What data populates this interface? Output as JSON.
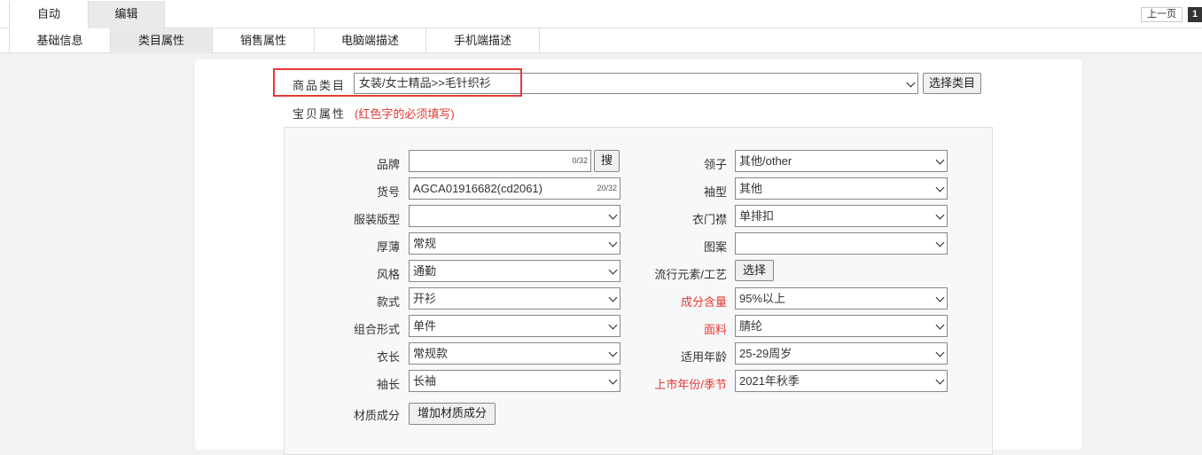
{
  "top_tabs": [
    {
      "label": "自动"
    },
    {
      "label": "编辑"
    }
  ],
  "pager": {
    "prev_label": "上一页",
    "current_page": "1"
  },
  "sub_tabs": [
    {
      "label": "基础信息"
    },
    {
      "label": "类目属性",
      "active": true
    },
    {
      "label": "销售属性"
    },
    {
      "label": "电脑端描述"
    },
    {
      "label": "手机端描述"
    }
  ],
  "category": {
    "label": "商品类目",
    "value": "女装/女士精品>>毛针织衫",
    "select_button": "选择类目"
  },
  "attributes_header": {
    "label": "宝贝属性",
    "note": "(红色字的必须填写)"
  },
  "left_fields": [
    {
      "label": "品牌",
      "type": "text",
      "value": "",
      "counter": "0/32",
      "button": "搜"
    },
    {
      "label": "货号",
      "type": "text",
      "value": "AGCA01916682(cd2061)",
      "counter": "20/32"
    },
    {
      "label": "服装版型",
      "type": "select",
      "value": ""
    },
    {
      "label": "厚薄",
      "type": "select",
      "value": "常规"
    },
    {
      "label": "风格",
      "type": "select",
      "value": "通勤"
    },
    {
      "label": "款式",
      "type": "select",
      "value": "开衫"
    },
    {
      "label": "组合形式",
      "type": "select",
      "value": "单件"
    },
    {
      "label": "衣长",
      "type": "select",
      "value": "常规款"
    },
    {
      "label": "袖长",
      "type": "select",
      "value": "长袖"
    },
    {
      "label": "材质成分",
      "type": "button",
      "button": "增加材质成分"
    }
  ],
  "right_fields": [
    {
      "label": "领子",
      "type": "select",
      "value": "其他/other",
      "required": false
    },
    {
      "label": "袖型",
      "type": "select",
      "value": "其他",
      "required": false
    },
    {
      "label": "衣门襟",
      "type": "select",
      "value": "单排扣",
      "required": false
    },
    {
      "label": "图案",
      "type": "select",
      "value": "",
      "required": false
    },
    {
      "label": "流行元素/工艺",
      "type": "button",
      "button": "选择",
      "required": false
    },
    {
      "label": "成分含量",
      "type": "select",
      "value": "95%以上",
      "required": true
    },
    {
      "label": "面料",
      "type": "select",
      "value": "腈纶",
      "required": true
    },
    {
      "label": "适用年龄",
      "type": "select",
      "value": "25-29周岁",
      "required": false
    },
    {
      "label": "上市年份/季节",
      "type": "select",
      "value": "2021年秋季",
      "required": true
    }
  ],
  "colors": {
    "required": "#e53935",
    "highlight": "#e53935"
  }
}
